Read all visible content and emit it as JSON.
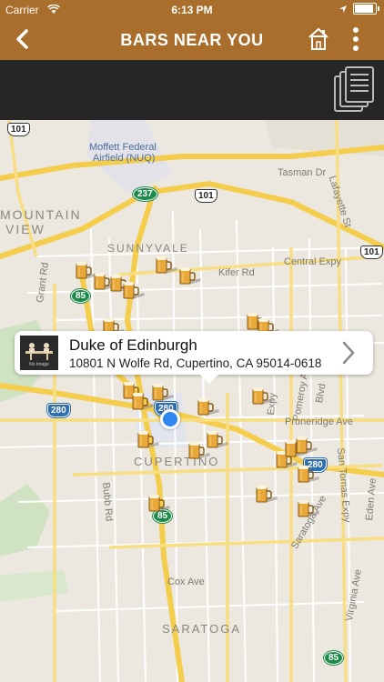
{
  "status": {
    "carrier": "Carrier",
    "time": "6:13 PM"
  },
  "nav": {
    "title": "BARS NEAR YOU",
    "back_icon": "chevron-left-icon",
    "home_icon": "home-icon",
    "more_icon": "more-vertical-icon"
  },
  "toolbar": {
    "list_icon": "documents-icon"
  },
  "map": {
    "labels": {
      "mountain_view_1": "MOUNTAIN",
      "mountain_view_2": "VIEW",
      "moffett_1": "Moffett Federal",
      "moffett_2": "Airfield (NUQ)",
      "tasman": "Tasman Dr",
      "lafayette": "Lafayette St",
      "grant": "Grant Rd",
      "sunnyvale": "SUNNYVALE",
      "kifer": "Kifer Rd",
      "central": "Central Expy",
      "pomeroy": "Pomeroy Ave",
      "pruneridge": "Pruneridge Ave",
      "cupertino": "CUPERTINO",
      "san_tomas": "San Tomas Expy",
      "bubb": "Bubb Rd",
      "saratoga_ave": "Saratoga Ave",
      "eden": "Eden Ave",
      "cox": "Cox Ave",
      "virginia": "Virginia Ave",
      "saratoga": "SARATOGA",
      "expy": "Expy",
      "blvd": "Blvd"
    },
    "shields": {
      "us101_a": "101",
      "us101_b": "101",
      "us101_c": "101",
      "i280_a": "280",
      "i280_b": "280",
      "i280_c": "280",
      "sr237": "237",
      "sr85_a": "85",
      "sr85_b": "85",
      "sr85_c": "85"
    }
  },
  "callout": {
    "name": "Duke of Edinburgh",
    "address": "10801 N Wolfe Rd, Cupertino, CA 95014-0618",
    "thumb_caption": "No Image",
    "chevron_icon": "chevron-right-icon"
  }
}
